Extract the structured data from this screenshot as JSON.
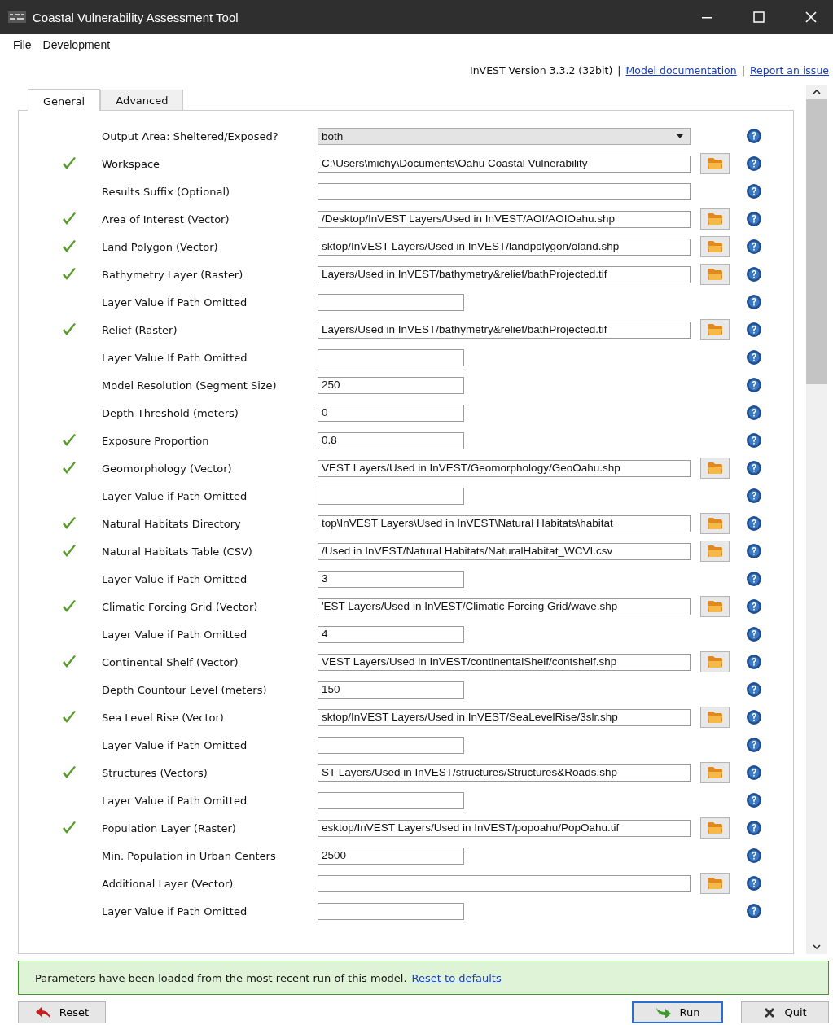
{
  "window": {
    "title": "Coastal Vulnerability Assessment Tool"
  },
  "menu": [
    {
      "label": "File"
    },
    {
      "label": "Development"
    }
  ],
  "header": {
    "version": "InVEST Version 3.3.2 (32bit)",
    "separator": "|",
    "links": [
      "Model documentation",
      "Report an issue"
    ]
  },
  "tabs": [
    {
      "label": "General",
      "selected": true
    },
    {
      "label": "Advanced",
      "selected": false
    }
  ],
  "rows": [
    {
      "label": "Output Area: Sheltered/Exposed?",
      "valid": false,
      "kind": "dropdown",
      "value": "both"
    },
    {
      "label": "Workspace",
      "valid": true,
      "kind": "path",
      "value": "C:\\Users\\michy\\Documents\\Oahu Coastal Vulnerability"
    },
    {
      "label": "Results Suffix (Optional)",
      "valid": false,
      "kind": "wide",
      "value": ""
    },
    {
      "label": "Area of Interest (Vector)",
      "valid": true,
      "kind": "path",
      "value": "/Desktop/InVEST Layers/Used in InVEST/AOI/AOIOahu.shp"
    },
    {
      "label": "Land Polygon (Vector)",
      "valid": true,
      "kind": "path",
      "value": "sktop/InVEST Layers/Used in InVEST/landpolygon/oland.shp"
    },
    {
      "label": "Bathymetry Layer (Raster)",
      "valid": true,
      "kind": "path",
      "value": "Layers/Used in InVEST/bathymetry&relief/bathProjected.tif"
    },
    {
      "label": "Layer Value if Path Omitted",
      "valid": false,
      "kind": "short",
      "value": ""
    },
    {
      "label": "Relief (Raster)",
      "valid": true,
      "kind": "path",
      "value": "Layers/Used in InVEST/bathymetry&relief/bathProjected.tif"
    },
    {
      "label": "Layer Value If Path Omitted",
      "valid": false,
      "kind": "short",
      "value": ""
    },
    {
      "label": "Model Resolution (Segment Size)",
      "valid": false,
      "kind": "short",
      "value": "250"
    },
    {
      "label": "Depth Threshold (meters)",
      "valid": false,
      "kind": "short",
      "value": "0"
    },
    {
      "label": "Exposure Proportion",
      "valid": true,
      "kind": "short",
      "value": "0.8"
    },
    {
      "label": "Geomorphology (Vector)",
      "valid": true,
      "kind": "path",
      "value": "VEST Layers/Used in InVEST/Geomorphology/GeoOahu.shp"
    },
    {
      "label": "Layer Value if Path Omitted",
      "valid": false,
      "kind": "short",
      "value": ""
    },
    {
      "label": "Natural Habitats Directory",
      "valid": true,
      "kind": "path",
      "value": "top\\InVEST Layers\\Used in InVEST\\Natural Habitats\\habitat"
    },
    {
      "label": "Natural Habitats Table (CSV)",
      "valid": true,
      "kind": "path",
      "value": "/Used in InVEST/Natural Habitats/NaturalHabitat_WCVI.csv"
    },
    {
      "label": "Layer Value if Path Omitted",
      "valid": false,
      "kind": "short",
      "value": "3"
    },
    {
      "label": "Climatic Forcing Grid (Vector)",
      "valid": true,
      "kind": "path",
      "value": "'EST Layers/Used in InVEST/Climatic Forcing Grid/wave.shp"
    },
    {
      "label": "Layer Value if Path Omitted",
      "valid": false,
      "kind": "short",
      "value": "4"
    },
    {
      "label": "Continental Shelf (Vector)",
      "valid": true,
      "kind": "path",
      "value": "VEST Layers/Used in InVEST/continentalShelf/contshelf.shp"
    },
    {
      "label": "Depth Countour Level (meters)",
      "valid": false,
      "kind": "short",
      "value": "150"
    },
    {
      "label": "Sea Level Rise (Vector)",
      "valid": true,
      "kind": "path",
      "value": "sktop/InVEST Layers/Used in InVEST/SeaLevelRise/3slr.shp"
    },
    {
      "label": "Layer Value if Path Omitted",
      "valid": false,
      "kind": "short",
      "value": ""
    },
    {
      "label": "Structures (Vectors)",
      "valid": true,
      "kind": "path",
      "value": "ST Layers/Used in InVEST/structures/Structures&Roads.shp"
    },
    {
      "label": "Layer Value if Path Omitted",
      "valid": false,
      "kind": "short",
      "value": ""
    },
    {
      "label": "Population Layer (Raster)",
      "valid": true,
      "kind": "path",
      "value": "esktop/InVEST Layers/Used in InVEST/popoahu/PopOahu.tif"
    },
    {
      "label": "Min. Population in Urban Centers",
      "valid": false,
      "kind": "short",
      "value": "2500"
    },
    {
      "label": "Additional Layer (Vector)",
      "valid": false,
      "kind": "path",
      "value": ""
    },
    {
      "label": "Layer Value if Path Omitted",
      "valid": false,
      "kind": "short",
      "value": ""
    }
  ],
  "message": {
    "text": "Parameters have been loaded from the most recent run of this model.",
    "link": "Reset to defaults"
  },
  "buttons": [
    {
      "label": "Reset",
      "kind": "reset",
      "focused": false
    },
    {
      "label": "Run",
      "kind": "run",
      "focused": true
    },
    {
      "label": "Quit",
      "kind": "quit",
      "focused": false
    }
  ]
}
